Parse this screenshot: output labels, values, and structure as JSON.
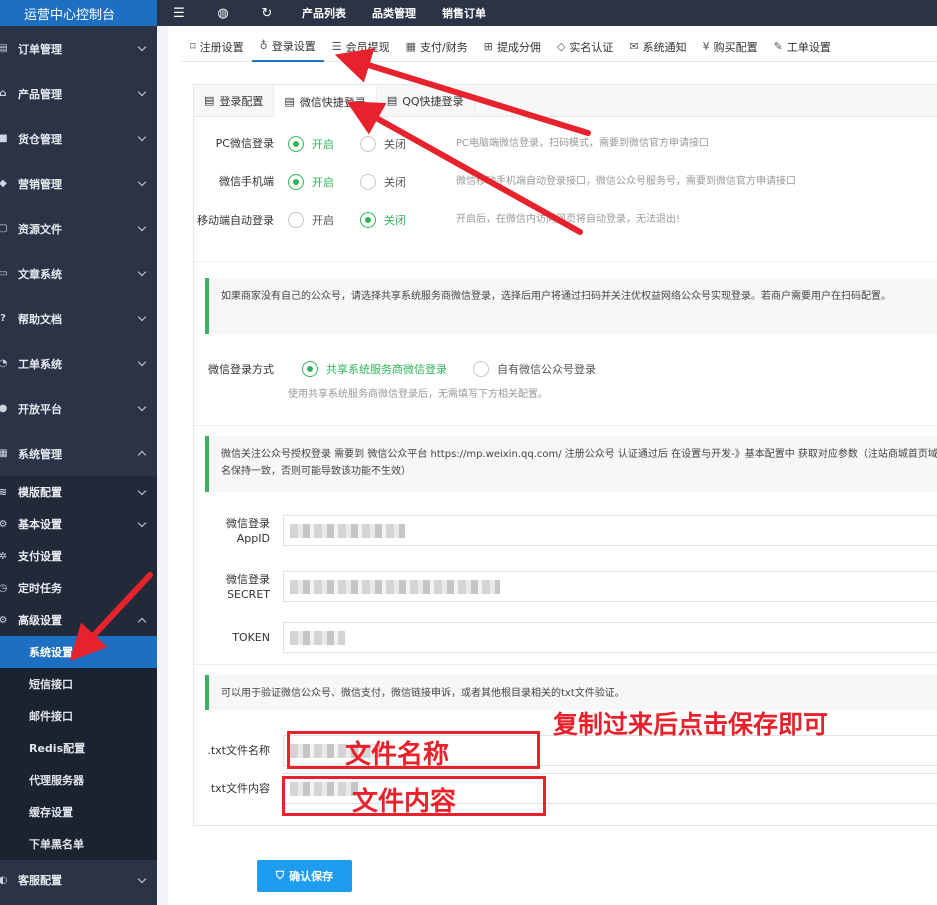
{
  "sidebar": {
    "title": "运营中心控制台",
    "items": [
      {
        "label": "订单管理",
        "icon": "clipboard-icon"
      },
      {
        "label": "产品管理",
        "icon": "cart-icon"
      },
      {
        "label": "货仓管理",
        "icon": "box-icon"
      },
      {
        "label": "营销管理",
        "icon": "megaphone-icon"
      },
      {
        "label": "资源文件",
        "icon": "file-icon"
      },
      {
        "label": "文章系统",
        "icon": "article-icon"
      },
      {
        "label": "帮助文档",
        "icon": "help-icon"
      },
      {
        "label": "工单系统",
        "icon": "ticket-icon"
      },
      {
        "label": "开放平台",
        "icon": "globe-icon"
      },
      {
        "label": "系统管理",
        "icon": "grid-icon"
      }
    ],
    "system_sub": [
      {
        "label": "模版配置",
        "icon": "layers-icon"
      },
      {
        "label": "基本设置",
        "icon": "gear-icon"
      },
      {
        "label": "支付设置",
        "icon": "pay-icon"
      },
      {
        "label": "定时任务",
        "icon": "clock-icon"
      },
      {
        "label": "高级设置",
        "icon": "settings-icon"
      }
    ],
    "advanced_sub": [
      "系统设置",
      "短信接口",
      "邮件接口",
      "Redis配置",
      "代理服务器",
      "缓存设置",
      "下单黑名单"
    ],
    "bottom_item": {
      "label": "客服配置",
      "icon": "headset-icon"
    }
  },
  "topbar": {
    "links": [
      "产品列表",
      "品类管理",
      "销售订单"
    ]
  },
  "tabs_top": [
    {
      "label": "注册设置",
      "icon": "tag-icon"
    },
    {
      "label": "登录设置",
      "icon": "pin-icon"
    },
    {
      "label": "会员提现",
      "icon": "list-icon"
    },
    {
      "label": "支付/财务",
      "icon": "calendar-icon"
    },
    {
      "label": "提成分佣",
      "icon": "gift-icon"
    },
    {
      "label": "实名认证",
      "icon": "shield-icon"
    },
    {
      "label": "系统通知",
      "icon": "mail-icon"
    },
    {
      "label": "购买配置",
      "icon": "yen-icon"
    },
    {
      "label": "工单设置",
      "icon": "edit-icon"
    }
  ],
  "tabs_inner": [
    {
      "label": "登录配置",
      "icon": "doc-icon"
    },
    {
      "label": "微信快捷登录",
      "icon": "doc-icon"
    },
    {
      "label": "QQ快捷登录",
      "icon": "doc-icon"
    }
  ],
  "settings": [
    {
      "label": "PC微信登录",
      "opt_on": "开启",
      "opt_off": "关闭",
      "value": "on",
      "hint": "PC电脑端微信登录，扫码模式，需要到微信官方申请接口"
    },
    {
      "label": "微信手机端",
      "opt_on": "开启",
      "opt_off": "关闭",
      "value": "on",
      "hint": "微信移动手机端自动登录接口，微信公众号服务号，需要到微信官方申请接口"
    },
    {
      "label": "移动端自动登录",
      "opt_on": "开启",
      "opt_off": "关闭",
      "value": "off",
      "hint": "开启后，在微信内访问网页将自动登录，无法退出!"
    }
  ],
  "notice1": "如果商家没有自己的公众号，请选择共享系统服务商微信登录，选择后用户将通过扫码并关注优权益网络公众号实现登录。若商户需要用户在扫码配置。",
  "login_mode": {
    "label": "微信登录方式",
    "opt1": "共享系统服务商微信登录",
    "opt2": "自有微信公众号登录",
    "value": "opt1",
    "hint": "使用共享系统服务商微信登录后，无需填写下方相关配置。"
  },
  "notice2": "微信关注公众号授权登录 需要到 微信公众平台 https://mp.weixin.qq.com/ 注册公众号 认证通过后 在设置与开发-》基本配置中 获取对应参数（注站商城首页域名保持一致，否则可能导致该功能不生效）",
  "fields": [
    {
      "label": "微信登录AppID"
    },
    {
      "label": "微信登录SECRET"
    },
    {
      "label": "TOKEN"
    }
  ],
  "notice3": "可以用于验证微信公众号、微信支付，微信链接申诉，或者其他根目录相关的txt文件验证。",
  "txt_fields": [
    {
      "label": ".txt文件名称"
    },
    {
      "label": "txt文件内容"
    }
  ],
  "annotations": {
    "hint": "复制过来后点击保存即可",
    "filename": "文件名称",
    "content": "文件内容",
    "color": "#e8222c"
  },
  "save_label": "确认保存",
  "colors": {
    "accent": "#1d6fc1",
    "success": "#2fb55a",
    "sidebar": "#2b3446",
    "button": "#1e9cf0"
  }
}
